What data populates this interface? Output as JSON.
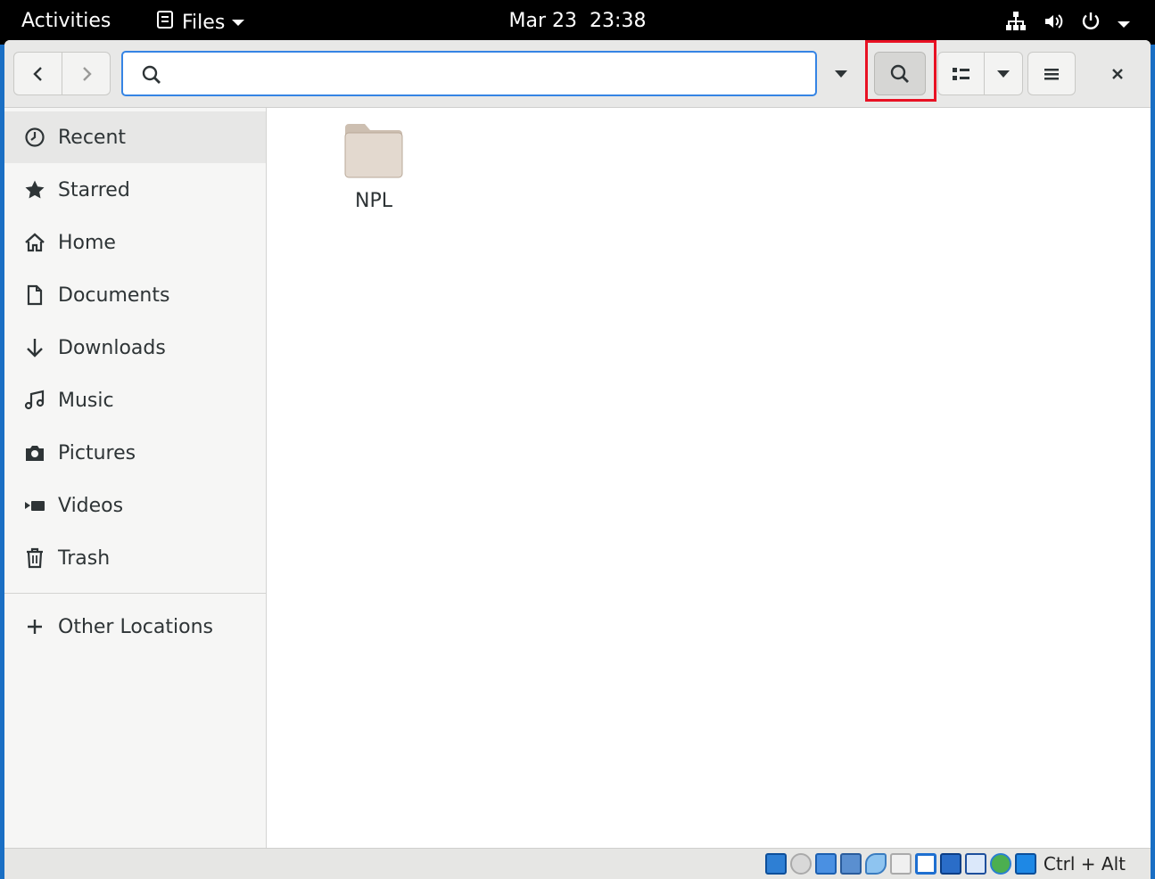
{
  "topbar": {
    "activities": "Activities",
    "app_name": "Files",
    "date": "Mar 23",
    "time": "23:38"
  },
  "search": {
    "value": "",
    "placeholder": ""
  },
  "sidebar": {
    "items": [
      {
        "label": "Recent",
        "icon": "clock-icon"
      },
      {
        "label": "Starred",
        "icon": "star-icon"
      },
      {
        "label": "Home",
        "icon": "home-icon"
      },
      {
        "label": "Documents",
        "icon": "document-icon"
      },
      {
        "label": "Downloads",
        "icon": "download-icon"
      },
      {
        "label": "Music",
        "icon": "music-icon"
      },
      {
        "label": "Pictures",
        "icon": "camera-icon"
      },
      {
        "label": "Videos",
        "icon": "video-icon"
      },
      {
        "label": "Trash",
        "icon": "trash-icon"
      }
    ],
    "other_locations": "Other Locations"
  },
  "files": [
    {
      "name": "NPL",
      "type": "folder"
    }
  ],
  "statusbar": {
    "host_key": "Ctrl + Alt"
  },
  "colors": {
    "accent": "#3584e4",
    "highlight": "#e81123",
    "folder": "#e3d9cf"
  }
}
